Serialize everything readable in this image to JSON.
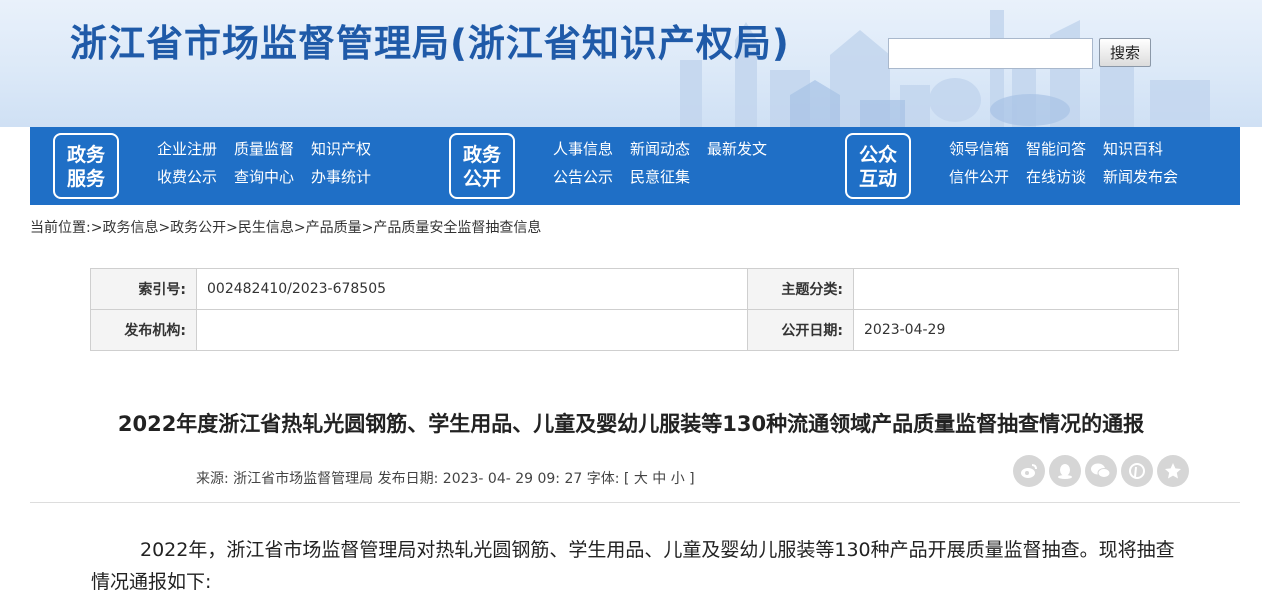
{
  "header": {
    "site_title": "浙江省市场监督管理局(浙江省知识产权局)",
    "search_placeholder": "",
    "search_button": "搜索"
  },
  "nav": {
    "groups": [
      {
        "badge": [
          "政务",
          "服务"
        ],
        "links": [
          "企业注册",
          "质量监督",
          "知识产权",
          "收费公示",
          "查询中心",
          "办事统计"
        ]
      },
      {
        "badge": [
          "政务",
          "公开"
        ],
        "links": [
          "人事信息",
          "新闻动态",
          "最新发文",
          "公告公示",
          "民意征集"
        ]
      },
      {
        "badge": [
          "公众",
          "互动"
        ],
        "links": [
          "领导信箱",
          "智能问答",
          "知识百科",
          "信件公开",
          "在线访谈",
          "新闻发布会"
        ]
      }
    ]
  },
  "breadcrumb": "当前位置:>政务信息>政务公开>民生信息>产品质量>产品质量安全监督抽查信息",
  "info": {
    "index_label": "索引号:",
    "index_value": "002482410/2023-678505",
    "topic_label": "主题分类:",
    "topic_value": "",
    "publisher_label": "发布机构:",
    "publisher_value": "",
    "date_label": "公开日期:",
    "date_value": "2023-04-29"
  },
  "article": {
    "title": "2022年度浙江省热轧光圆钢筋、学生用品、儿童及婴幼儿服装等130种流通领域产品质量监督抽查情况的通报",
    "meta": "来源: 浙江省市场监督管理局 发布日期: 2023- 04- 29 09: 27 字体: [ 大 中 小 ]",
    "share_icons": [
      "weibo-icon",
      "qq-icon",
      "wechat-icon",
      "pinterest-icon",
      "qzone-icon"
    ],
    "body": "2022年，浙江省市场监督管理局对热轧光圆钢筋、学生用品、儿童及婴幼儿服装等130种产品开展质量监督抽查。现将抽查情况通报如下:"
  },
  "colors": {
    "nav_bg": "#1f6fc6",
    "title_blue": "#1f5aa8",
    "share_gray": "#d6d6d6"
  }
}
